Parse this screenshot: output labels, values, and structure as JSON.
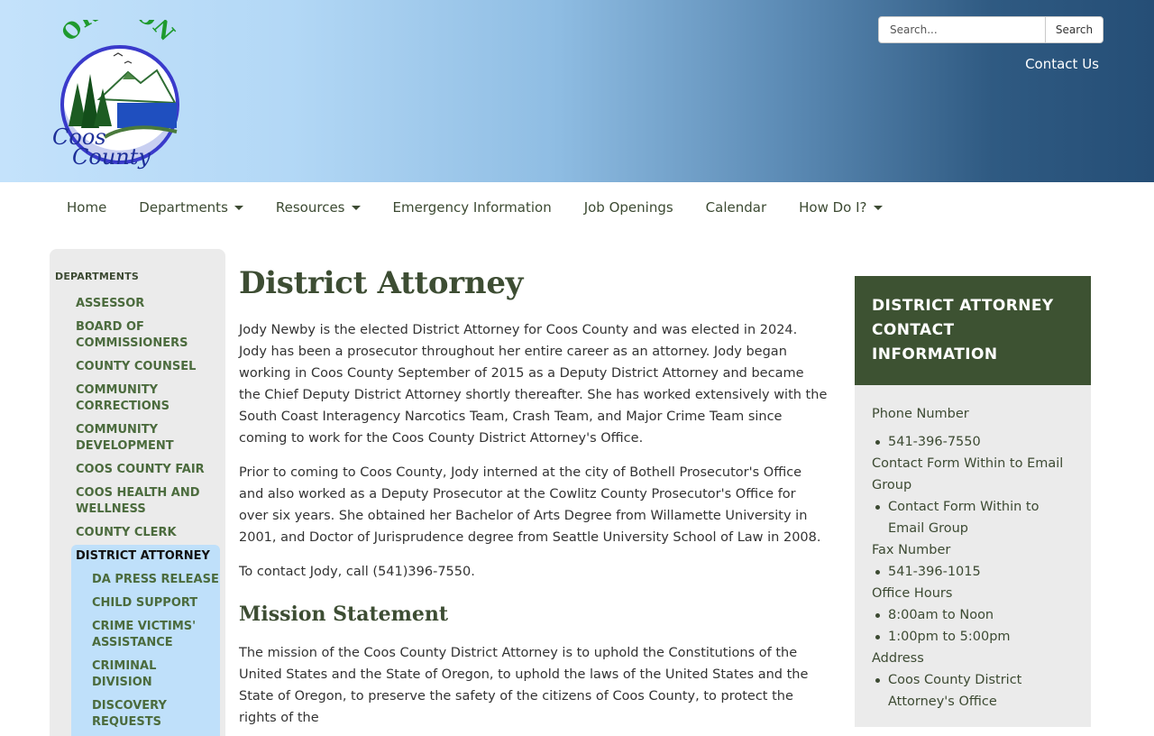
{
  "header": {
    "logo_top_text": "OREGON",
    "logo_line1": "Coos",
    "logo_line2": "County",
    "search_placeholder": "Search...",
    "search_button": "Search",
    "contact_link": "Contact Us"
  },
  "nav": {
    "items": [
      {
        "label": "Home",
        "has_dropdown": false
      },
      {
        "label": "Departments",
        "has_dropdown": true
      },
      {
        "label": "Resources",
        "has_dropdown": true
      },
      {
        "label": "Emergency Information",
        "has_dropdown": false
      },
      {
        "label": "Job Openings",
        "has_dropdown": false
      },
      {
        "label": "Calendar",
        "has_dropdown": false
      },
      {
        "label": "How Do I?",
        "has_dropdown": true
      }
    ]
  },
  "sidebar": {
    "title": "DEPARTMENTS",
    "items": [
      "ASSESSOR",
      "BOARD OF COMMISSIONERS",
      "COUNTY COUNSEL",
      "COMMUNITY CORRECTIONS",
      "COMMUNITY DEVELOPMENT",
      "COOS COUNTY FAIR",
      "COOS HEALTH AND WELLNESS",
      "COUNTY CLERK"
    ],
    "active": "DISTRICT ATTORNEY",
    "sub_items": [
      "DA PRESS RELEASE",
      "CHILD SUPPORT",
      "CRIME VICTIMS' ASSISTANCE",
      "CRIMINAL DIVISION",
      "DISCOVERY REQUESTS"
    ]
  },
  "main": {
    "title": "District Attorney",
    "paragraphs": [
      "Jody Newby is the elected District Attorney for Coos County and was elected in 2024.  Jody has been a prosecutor throughout her entire career as an attorney.  Jody began working in Coos County September of 2015 as a Deputy District Attorney and became the Chief Deputy District Attorney shortly thereafter.  She has worked extensively with the South Coast Interagency Narcotics Team, Crash Team, and Major Crime Team since coming to work for the Coos County District Attorney's Office.",
      "Prior to coming to Coos County, Jody interned at the city of Bothell Prosecutor's Office and also worked as a Deputy Prosecutor at the Cowlitz County Prosecutor's Office for over six years.  She obtained her Bachelor of Arts Degree from Willamette University in 2001, and Doctor of Jurisprudence degree from Seattle University School of Law in 2008.",
      "To contact Jody, call (541)396-7550."
    ],
    "mission_title": "Mission Statement",
    "mission_text": "The mission of the Coos County District Attorney is to uphold the Constitutions of the United States and the State of Oregon, to uphold the laws of the United States and the State of Oregon, to preserve the safety of the citizens of Coos County, to protect the rights of the"
  },
  "contact_card": {
    "title": "DISTRICT ATTORNEY CONTACT INFORMATION",
    "phone_label": "Phone Number",
    "phone": "541-396-7550",
    "email_label": "Contact Form Within to Email Group",
    "email_item": "Contact Form Within to Email Group",
    "fax_label": "Fax Number",
    "fax": "541-396-1015",
    "hours_label": "Office Hours",
    "hours": [
      "8:00am to Noon",
      "1:00pm to 5:00pm"
    ],
    "address_label": "Address",
    "address": "Coos County District Attorney's Office"
  },
  "colors": {
    "nav_text": "#3c4a32",
    "heading": "#3d4d33",
    "sidebar_link": "#4b6b3d",
    "sidebar_active_bg": "#bfe0fa",
    "card_header_bg": "#3d5232"
  }
}
